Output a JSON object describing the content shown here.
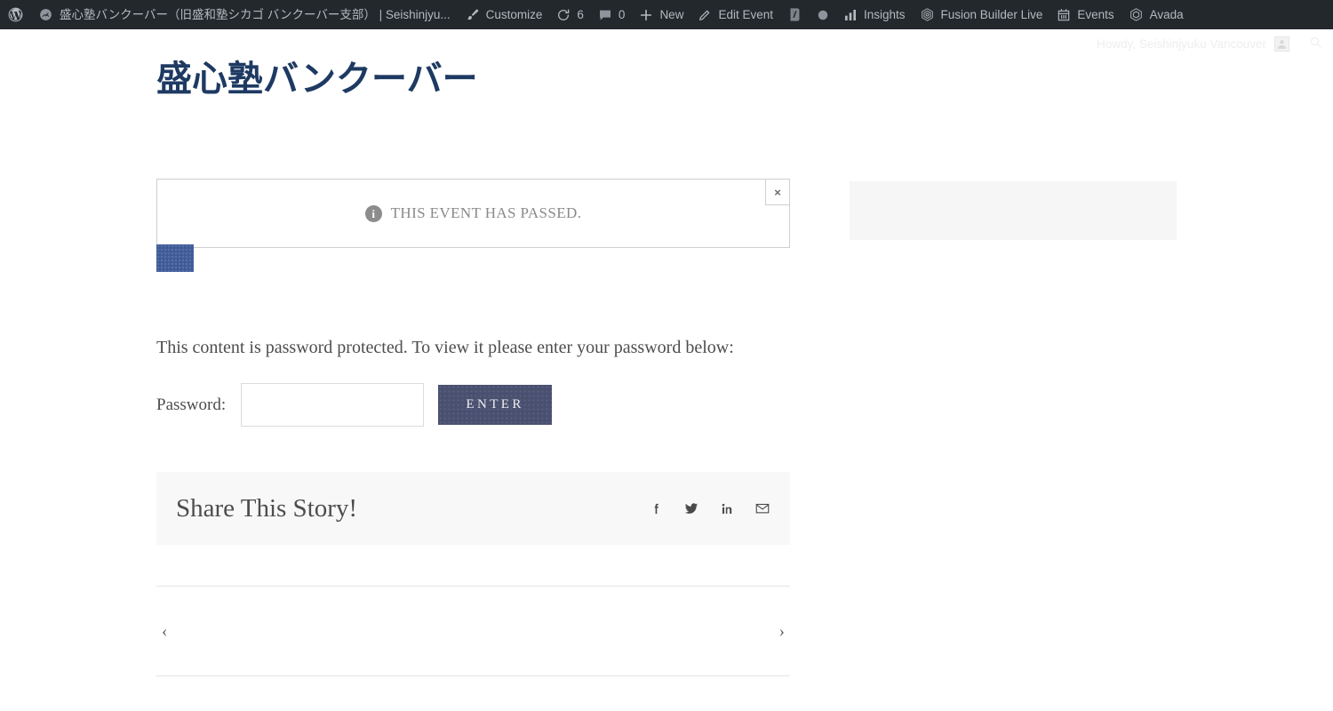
{
  "admin_bar": {
    "items": [
      {
        "icon": "wordpress-logo-icon",
        "label": ""
      },
      {
        "icon": "dashboard-speedometer-icon",
        "label": "盛心塾バンクーバー（旧盛和塾シカゴ バンクーバー支部） | Seishinjyu..."
      },
      {
        "icon": "paintbrush-icon",
        "label": "Customize"
      },
      {
        "icon": "updates-refresh-icon",
        "label": "6"
      },
      {
        "icon": "comment-bubble-icon",
        "label": "0"
      },
      {
        "icon": "plus-icon",
        "label": "New"
      },
      {
        "icon": "pencil-icon",
        "label": "Edit Event"
      },
      {
        "icon": "yoast-seo-icon",
        "label": ""
      },
      {
        "icon": "seo-score-dot-icon",
        "label": ""
      },
      {
        "icon": "insights-bars-icon",
        "label": "Insights"
      },
      {
        "icon": "fusion-builder-icon",
        "label": "Fusion Builder Live"
      },
      {
        "icon": "events-calendar-icon",
        "label": "Events"
      },
      {
        "icon": "avada-icon",
        "label": "Avada"
      }
    ],
    "howdy": "Howdy, Seishinjyuku Vancouver",
    "avatar_name": "avatar",
    "search_name": "search-icon"
  },
  "site": {
    "title": "盛心塾バンクーバー"
  },
  "notice": {
    "text": "THIS EVENT HAS PASSED.",
    "info_glyph": "i",
    "close_glyph": "×"
  },
  "password_form": {
    "message": "This content is password protected. To view it please enter your password below:",
    "label": "Password:",
    "value": "",
    "placeholder": "",
    "submit_label": "Enter"
  },
  "share": {
    "title": "Share This Story!",
    "icons": [
      {
        "name": "facebook-icon",
        "title": "Facebook"
      },
      {
        "name": "twitter-icon",
        "title": "Twitter"
      },
      {
        "name": "linkedin-icon",
        "title": "LinkedIn"
      },
      {
        "name": "email-icon",
        "title": "Email"
      }
    ]
  },
  "post_nav": {
    "prev_glyph": "‹",
    "next_glyph": "›"
  },
  "colors": {
    "admin_bar_bg": "#23282d",
    "site_title": "#1e3a63",
    "accent_blue": "#3f5c99",
    "button_bg": "#4a5070",
    "share_bg": "#f8f8f8",
    "widget_bg": "#f6f6f6"
  }
}
